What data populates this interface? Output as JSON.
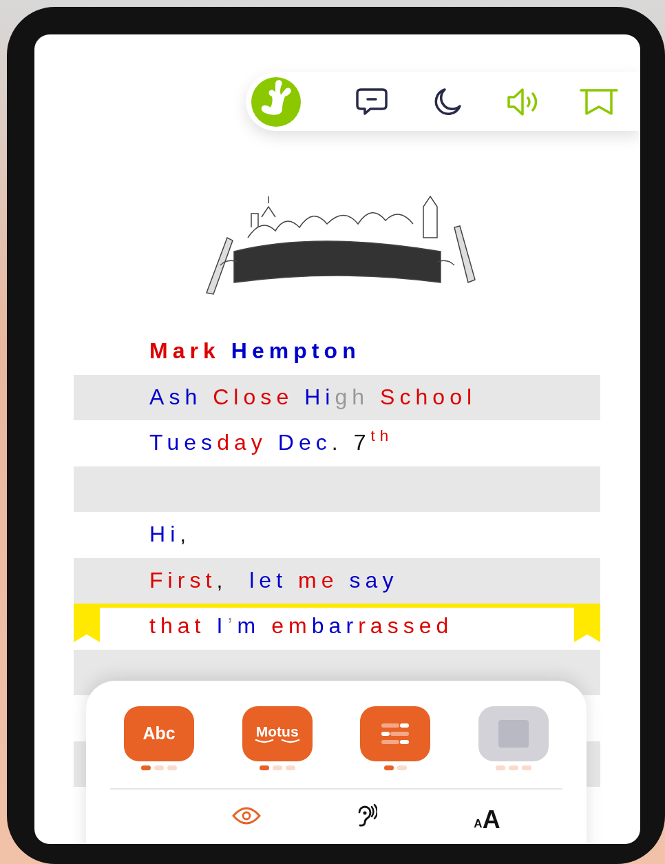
{
  "toolbar": {
    "items": [
      {
        "kind": "logo"
      },
      {
        "kind": "comment",
        "on": false
      },
      {
        "kind": "night",
        "on": false
      },
      {
        "kind": "sound",
        "on": true
      },
      {
        "kind": "bookmark",
        "on": true
      }
    ]
  },
  "lines": [
    {
      "band": false,
      "bold": true,
      "highlighted": false,
      "segments": [
        {
          "text": "Mark ",
          "color": "#dd0000",
          "raised": false
        },
        {
          "text": "Hempton",
          "color": "#0000cc",
          "raised": false
        }
      ]
    },
    {
      "band": true,
      "bold": false,
      "highlighted": false,
      "segments": [
        {
          "text": "Ash ",
          "color": "#0000cc",
          "raised": false
        },
        {
          "text": "Close ",
          "color": "#dd0000",
          "raised": false
        },
        {
          "text": "Hi",
          "color": "#0000cc",
          "raised": false
        },
        {
          "text": "gh ",
          "color": "#999999",
          "raised": false
        },
        {
          "text": "School",
          "color": "#dd0000",
          "raised": false
        }
      ]
    },
    {
      "band": false,
      "bold": false,
      "highlighted": false,
      "segments": [
        {
          "text": "Tues",
          "color": "#0000cc",
          "raised": false
        },
        {
          "text": "day ",
          "color": "#dd0000",
          "raised": false
        },
        {
          "text": "Dec",
          "color": "#0000cc",
          "raised": false
        },
        {
          "text": ". ",
          "color": "#111111",
          "raised": false
        },
        {
          "text": "7",
          "color": "#111111",
          "raised": false
        },
        {
          "text": "th",
          "color": "#dd0000",
          "raised": true
        }
      ]
    },
    {
      "band": true,
      "highlighted": false
    },
    {
      "band": false,
      "bold": false,
      "highlighted": false,
      "segments": [
        {
          "text": "Hi",
          "color": "#0000cc",
          "raised": false
        },
        {
          "text": ",",
          "color": "#111111",
          "raised": false
        }
      ]
    },
    {
      "band": true,
      "bold": false,
      "highlighted": false,
      "segments": [
        {
          "text": "First",
          "color": "#dd0000",
          "raised": false
        },
        {
          "text": ",  ",
          "color": "#111111",
          "raised": false
        },
        {
          "text": "let ",
          "color": "#0000cc",
          "raised": false
        },
        {
          "text": "me ",
          "color": "#dd0000",
          "raised": false
        },
        {
          "text": "say",
          "color": "#0000cc",
          "raised": false
        }
      ]
    },
    {
      "band": false,
      "bold": false,
      "highlighted": true,
      "segments": [
        {
          "text": "that ",
          "color": "#dd0000",
          "raised": false
        },
        {
          "text": "I",
          "color": "#0000cc",
          "raised": false
        },
        {
          "text": "’",
          "color": "#999999",
          "raised": false
        },
        {
          "text": "m ",
          "color": "#0000cc",
          "raised": false
        },
        {
          "text": "em",
          "color": "#dd0000",
          "raised": false
        },
        {
          "text": "bar",
          "color": "#0000cc",
          "raised": false
        },
        {
          "text": "rassed",
          "color": "#dd0000",
          "raised": false
        }
      ]
    },
    {
      "band": true,
      "highlighted": false
    },
    {
      "band": false,
      "highlighted": false
    },
    {
      "band": true,
      "highlighted": false
    }
  ],
  "panel": {
    "modes": [
      {
        "kind": "abc",
        "label": "Abc",
        "disabled": false,
        "dots": [
          {
            "selected": true
          },
          {
            "selected": false
          },
          {
            "selected": false
          }
        ]
      },
      {
        "kind": "motus",
        "label": "Motus",
        "disabled": false,
        "dots": [
          {
            "selected": true
          },
          {
            "selected": false
          },
          {
            "selected": false
          }
        ]
      },
      {
        "kind": "lines",
        "disabled": false,
        "dots": [
          {
            "selected": true
          },
          {
            "selected": false
          }
        ]
      },
      {
        "kind": "blank",
        "disabled": true,
        "dots": [
          {
            "selected": false
          },
          {
            "selected": false
          },
          {
            "selected": false
          }
        ]
      }
    ],
    "tabs": [
      {
        "kind": "eye",
        "selected": true
      },
      {
        "kind": "ear",
        "selected": false
      },
      {
        "kind": "font-size",
        "small": "A",
        "large": "A",
        "selected": false
      }
    ]
  }
}
